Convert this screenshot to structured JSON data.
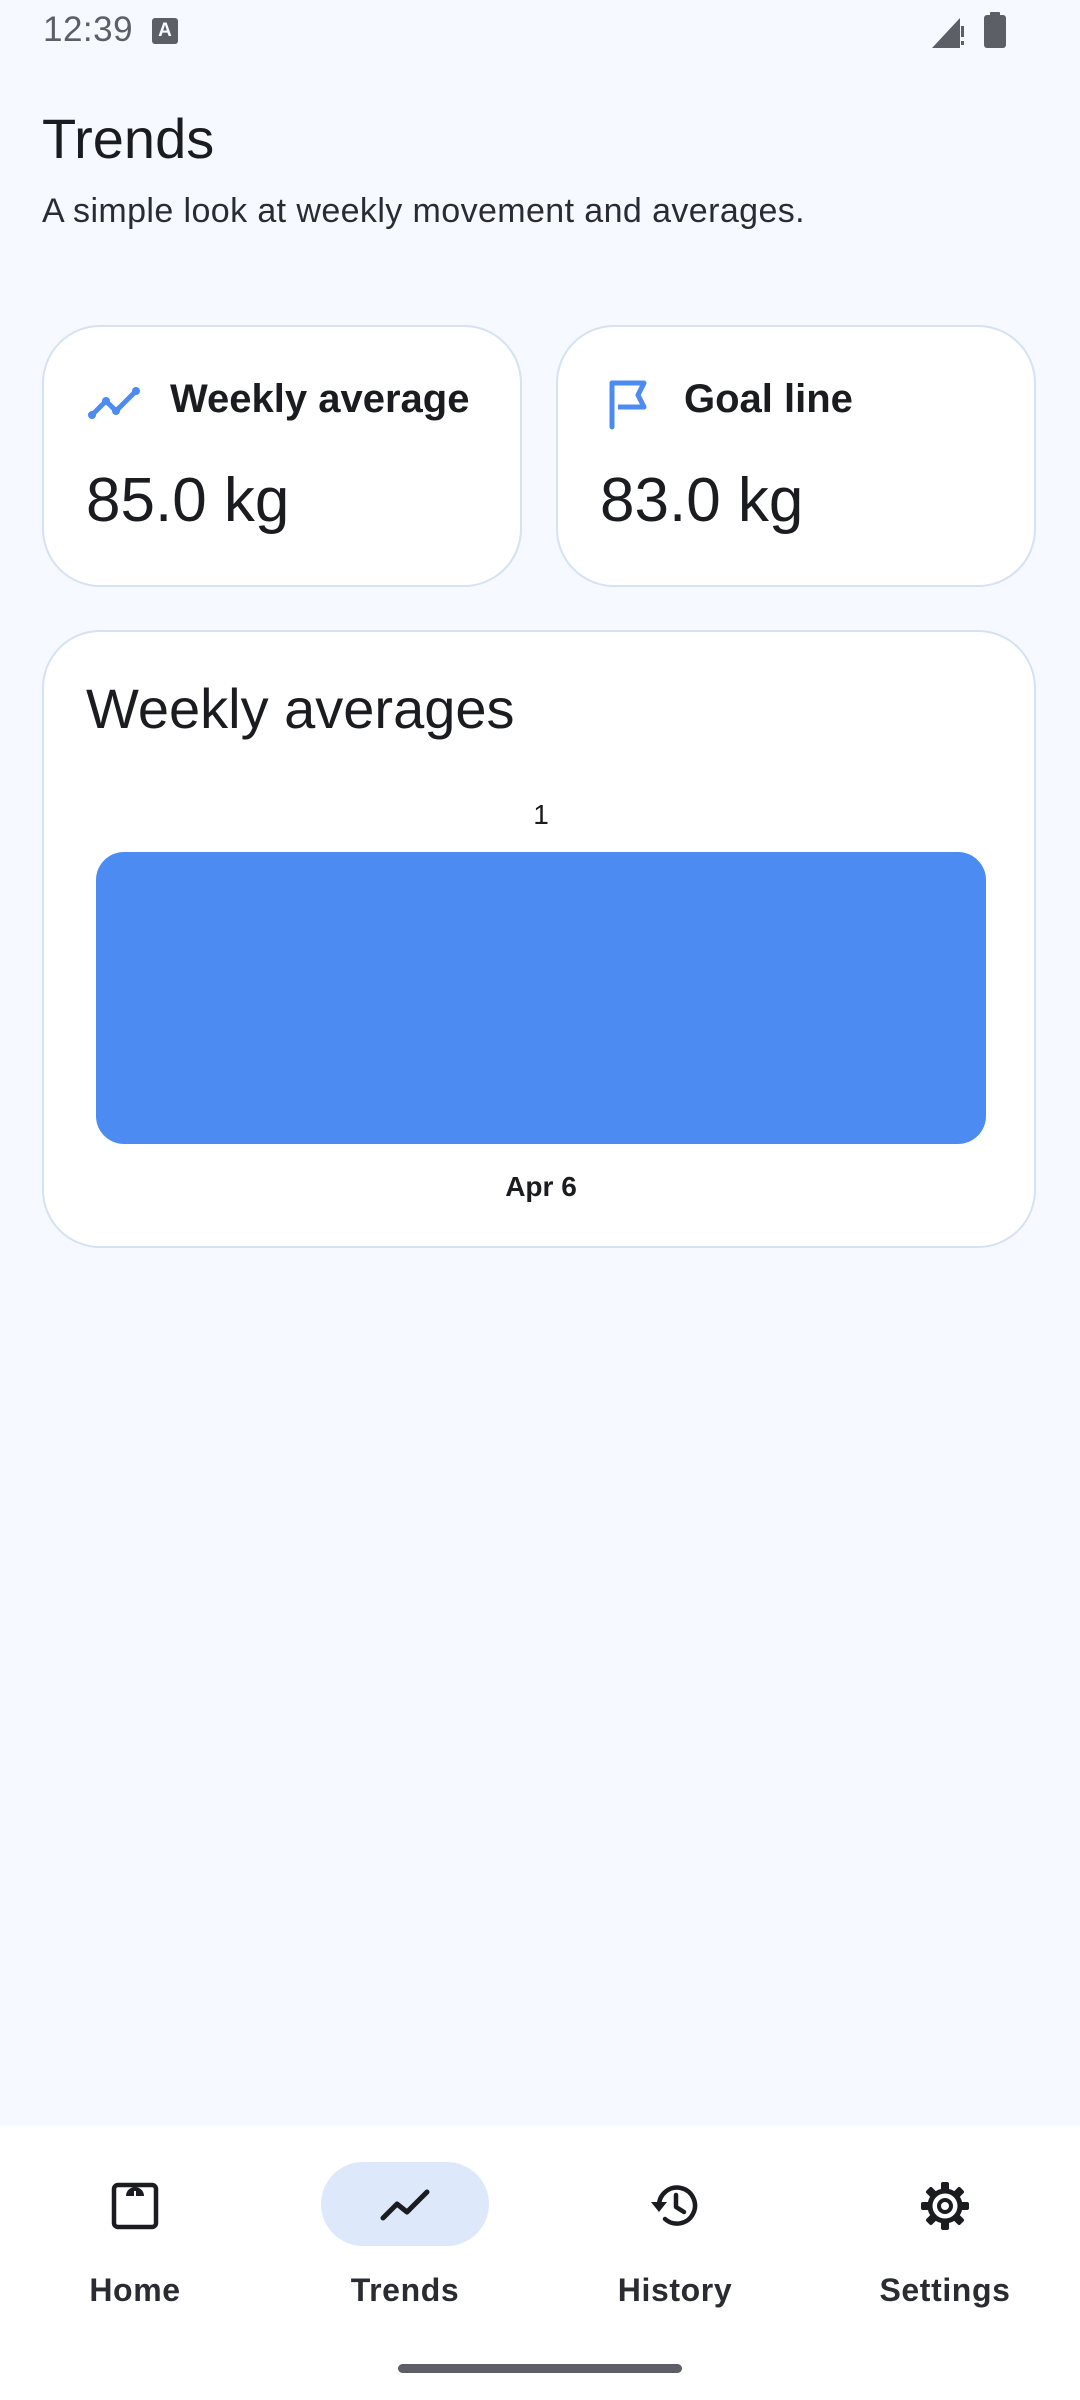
{
  "status_bar": {
    "time": "12:39",
    "notification_glyph": "A"
  },
  "header": {
    "title": "Trends",
    "subtitle": "A simple look at weekly movement and averages."
  },
  "cards": {
    "weekly_average": {
      "icon": "trending-up-icon",
      "label": "Weekly average",
      "value": "85.0 kg"
    },
    "goal_line": {
      "icon": "flag-icon",
      "label": "Goal line",
      "value": "83.0 kg"
    }
  },
  "chart": {
    "title": "Weekly averages"
  },
  "chart_data": {
    "type": "bar",
    "title": "Weekly averages",
    "categories": [
      "Apr 6"
    ],
    "values": [
      1
    ],
    "data_labels": [
      "1"
    ],
    "ylim": [
      0,
      1
    ],
    "grid": false,
    "bar_color": "#4c8bf2"
  },
  "nav": {
    "items": [
      {
        "label": "Home",
        "icon": "scale-icon",
        "active": false
      },
      {
        "label": "Trends",
        "icon": "trending-up-icon",
        "active": true
      },
      {
        "label": "History",
        "icon": "history-icon",
        "active": false
      },
      {
        "label": "Settings",
        "icon": "gear-icon",
        "active": false
      }
    ]
  },
  "colors": {
    "accent": "#4c8bf2",
    "background": "#f6f9ff",
    "card_border": "#d6e1f2",
    "active_nav_pill": "#dde9fb"
  }
}
